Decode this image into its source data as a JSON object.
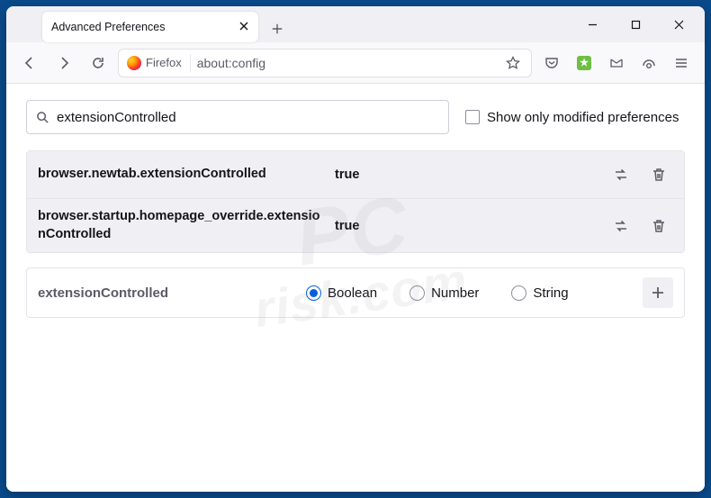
{
  "tab": {
    "title": "Advanced Preferences"
  },
  "urlbar": {
    "identity": "Firefox",
    "url": "about:config"
  },
  "search": {
    "value": "extensionControlled",
    "checkbox_label": "Show only modified preferences"
  },
  "prefs": [
    {
      "name": "browser.newtab.extensionControlled",
      "value": "true"
    },
    {
      "name": "browser.startup.homepage_override.extensionControlled",
      "value": "true"
    }
  ],
  "new_pref": {
    "name": "extensionControlled",
    "types": [
      "Boolean",
      "Number",
      "String"
    ],
    "selected": "Boolean"
  },
  "watermark": {
    "line1": "PC",
    "line2": "risk.com"
  }
}
